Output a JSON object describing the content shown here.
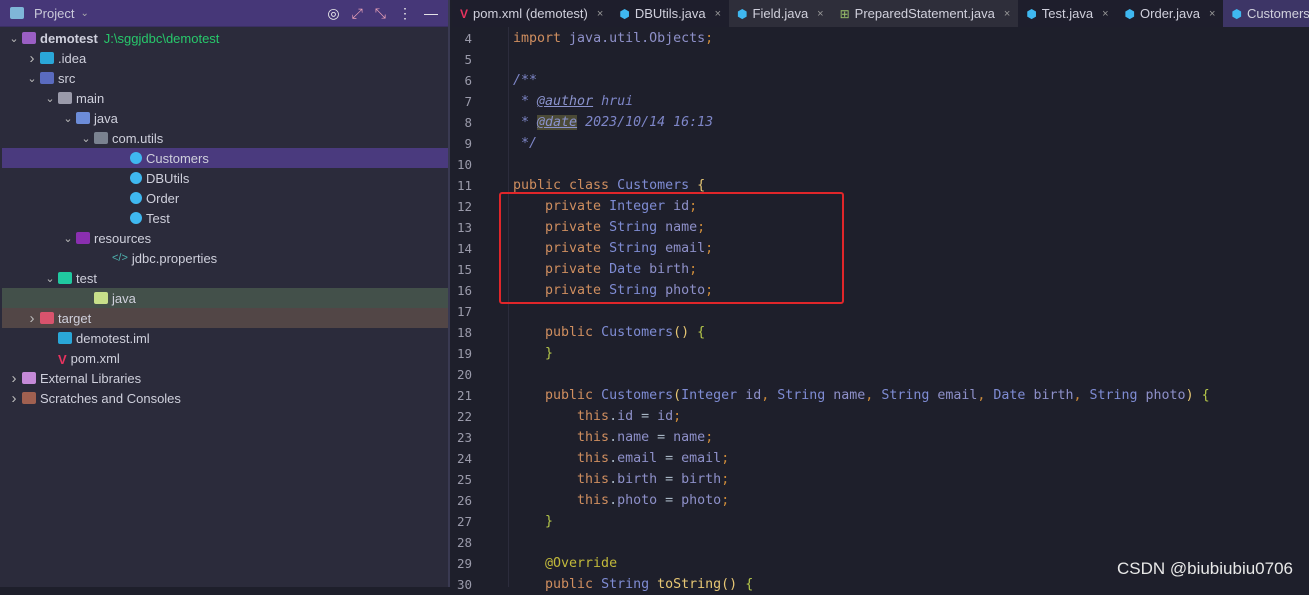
{
  "sidebar": {
    "title": "Project",
    "tree": [
      {
        "label": "demotest",
        "path": "J:\\sggjdbc\\demotest",
        "depth": 0,
        "arrow": "down",
        "icon": "module-folder-icon",
        "color": "#9a5fc4",
        "bold": true
      },
      {
        "label": ".idea",
        "depth": 1,
        "arrow": "right",
        "icon": "idea-folder-icon",
        "color": "#2aa7d8"
      },
      {
        "label": "src",
        "depth": 1,
        "arrow": "down",
        "icon": "source-folder-icon",
        "color": "#5a6bbf"
      },
      {
        "label": "main",
        "depth": 2,
        "arrow": "down",
        "icon": "folder-icon",
        "color": "#9a9aaa"
      },
      {
        "label": "java",
        "depth": 3,
        "arrow": "down",
        "icon": "java-folder-icon",
        "color": "#6c8cd8"
      },
      {
        "label": "com.utils",
        "depth": 4,
        "arrow": "down",
        "icon": "package-icon",
        "color": "#7a8290"
      },
      {
        "label": "Customers",
        "depth": 6,
        "icon": "class-icon",
        "color": "#3fb8f0",
        "state": "sel"
      },
      {
        "label": "DBUtils",
        "depth": 6,
        "icon": "class-icon",
        "color": "#3fb8f0"
      },
      {
        "label": "Order",
        "depth": 6,
        "icon": "class-icon",
        "color": "#3fb8f0"
      },
      {
        "label": "Test",
        "depth": 6,
        "icon": "main-class-icon",
        "color": "#3fb8f0"
      },
      {
        "label": "resources",
        "depth": 3,
        "arrow": "down",
        "icon": "resources-folder-icon",
        "color": "#8a2fb0"
      },
      {
        "label": "jdbc.properties",
        "depth": 5,
        "icon": "properties-file-icon",
        "color": "#4fb3b0"
      },
      {
        "label": "test",
        "depth": 2,
        "arrow": "down",
        "icon": "test-folder-icon",
        "color": "#20c9a0"
      },
      {
        "label": "java",
        "depth": 4,
        "icon": "test-java-folder-icon",
        "color": "#c7e08a",
        "state": "grn"
      },
      {
        "label": "target",
        "depth": 1,
        "arrow": "right",
        "icon": "excluded-folder-icon",
        "color": "#d9536d",
        "state": "red"
      },
      {
        "label": "demotest.iml",
        "depth": 2,
        "icon": "iml-file-icon",
        "color": "#2aa7d8"
      },
      {
        "label": "pom.xml",
        "depth": 2,
        "icon": "maven-icon",
        "color": "#e8335f"
      },
      {
        "label": "External Libraries",
        "depth": 0,
        "arrow": "right",
        "icon": "library-icon",
        "color": "#c58ad8"
      },
      {
        "label": "Scratches and Consoles",
        "depth": 0,
        "arrow": "right",
        "icon": "scratches-icon",
        "color": "#a06050"
      }
    ]
  },
  "tabs": [
    {
      "label": "pom.xml (demotest)",
      "icon": "maven-icon",
      "color": "#e8335f"
    },
    {
      "label": "DBUtils.java",
      "icon": "class-icon",
      "color": "#3fb8f0"
    },
    {
      "label": "Field.java",
      "icon": "class-icon",
      "color": "#3fb8f0",
      "state": "hl"
    },
    {
      "label": "PreparedStatement.java",
      "icon": "interface-icon",
      "color": "#9bc26b",
      "state": "hl"
    },
    {
      "label": "Test.java",
      "icon": "class-icon",
      "color": "#3fb8f0"
    },
    {
      "label": "Order.java",
      "icon": "class-icon",
      "color": "#3fb8f0"
    },
    {
      "label": "Customers.java",
      "icon": "class-icon",
      "color": "#3fb8f0",
      "state": "act"
    }
  ],
  "editor": {
    "first_line": 4,
    "lines": [
      [
        [
          "import ",
          "k"
        ],
        [
          "java.util.Objects",
          "v"
        ],
        [
          ";",
          "pn"
        ]
      ],
      [],
      [
        [
          "/**",
          "c"
        ]
      ],
      [
        [
          " * ",
          "c"
        ],
        [
          "@author",
          "tag"
        ],
        [
          " hrui",
          "c"
        ]
      ],
      [
        [
          " * ",
          "c"
        ],
        [
          "@date",
          "tag tagh"
        ],
        [
          " 2023/10/14 16:13",
          "c"
        ]
      ],
      [
        [
          " */",
          "c"
        ]
      ],
      [],
      [
        [
          "public class ",
          "k"
        ],
        [
          "Customers ",
          "t"
        ],
        [
          "{",
          "m"
        ]
      ],
      [
        [
          "    private ",
          "k"
        ],
        [
          "Integer ",
          "t"
        ],
        [
          "id",
          "v"
        ],
        [
          ";",
          "pn"
        ]
      ],
      [
        [
          "    private ",
          "k"
        ],
        [
          "String ",
          "t"
        ],
        [
          "name",
          "v"
        ],
        [
          ";",
          "pn"
        ]
      ],
      [
        [
          "    private ",
          "k"
        ],
        [
          "String ",
          "t"
        ],
        [
          "email",
          "v"
        ],
        [
          ";",
          "pn"
        ]
      ],
      [
        [
          "    private ",
          "k"
        ],
        [
          "Date ",
          "t"
        ],
        [
          "birth",
          "v"
        ],
        [
          ";",
          "pn"
        ]
      ],
      [
        [
          "    private ",
          "k"
        ],
        [
          "String ",
          "t"
        ],
        [
          "photo",
          "v"
        ],
        [
          ";",
          "pn"
        ]
      ],
      [],
      [
        [
          "    public ",
          "k"
        ],
        [
          "Customers",
          "t"
        ],
        [
          "() ",
          "m"
        ],
        [
          "{",
          "br"
        ]
      ],
      [
        [
          "    }",
          "br"
        ]
      ],
      [],
      [
        [
          "    public ",
          "k"
        ],
        [
          "Customers",
          "t"
        ],
        [
          "(",
          "m"
        ],
        [
          "Integer ",
          "t"
        ],
        [
          "id",
          "v"
        ],
        [
          ", ",
          "pn"
        ],
        [
          "String ",
          "t"
        ],
        [
          "name",
          "v"
        ],
        [
          ", ",
          "pn"
        ],
        [
          "String ",
          "t"
        ],
        [
          "email",
          "v"
        ],
        [
          ", ",
          "pn"
        ],
        [
          "Date ",
          "t"
        ],
        [
          "birth",
          "v"
        ],
        [
          ", ",
          "pn"
        ],
        [
          "String ",
          "t"
        ],
        [
          "photo",
          "v"
        ],
        [
          ") ",
          "m"
        ],
        [
          "{",
          "br"
        ]
      ],
      [
        [
          "        this",
          "k"
        ],
        [
          ".",
          "p"
        ],
        [
          "id",
          "v"
        ],
        [
          " = ",
          "p"
        ],
        [
          "id",
          "v"
        ],
        [
          ";",
          "pn"
        ]
      ],
      [
        [
          "        this",
          "k"
        ],
        [
          ".",
          "p"
        ],
        [
          "name",
          "v"
        ],
        [
          " = ",
          "p"
        ],
        [
          "name",
          "v"
        ],
        [
          ";",
          "pn"
        ]
      ],
      [
        [
          "        this",
          "k"
        ],
        [
          ".",
          "p"
        ],
        [
          "email",
          "v"
        ],
        [
          " = ",
          "p"
        ],
        [
          "email",
          "v"
        ],
        [
          ";",
          "pn"
        ]
      ],
      [
        [
          "        this",
          "k"
        ],
        [
          ".",
          "p"
        ],
        [
          "birth",
          "v"
        ],
        [
          " = ",
          "p"
        ],
        [
          "birth",
          "v"
        ],
        [
          ";",
          "pn"
        ]
      ],
      [
        [
          "        this",
          "k"
        ],
        [
          ".",
          "p"
        ],
        [
          "photo",
          "v"
        ],
        [
          " = ",
          "p"
        ],
        [
          "photo",
          "v"
        ],
        [
          ";",
          "pn"
        ]
      ],
      [
        [
          "    }",
          "br"
        ]
      ],
      [],
      [
        [
          "    @Override",
          "a"
        ]
      ],
      [
        [
          "    public ",
          "k"
        ],
        [
          "String ",
          "t"
        ],
        [
          "toString",
          "m"
        ],
        [
          "() ",
          "m"
        ],
        [
          "{",
          "br"
        ]
      ]
    ]
  },
  "watermark": "CSDN @biubiubiu0706"
}
